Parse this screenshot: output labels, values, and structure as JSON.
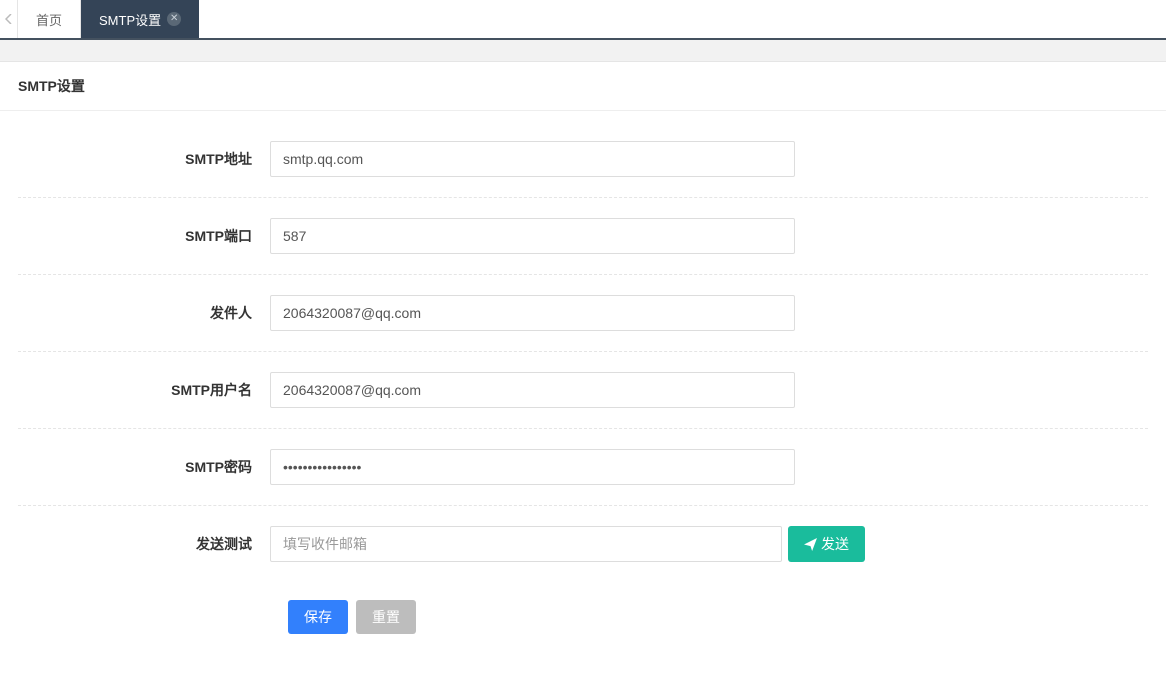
{
  "tabs": {
    "home": "首页",
    "active": "SMTP设置"
  },
  "panel": {
    "title": "SMTP设置"
  },
  "form": {
    "smtp_addr": {
      "label": "SMTP地址",
      "value": "smtp.qq.com"
    },
    "smtp_port": {
      "label": "SMTP端口",
      "value": "587"
    },
    "sender": {
      "label": "发件人",
      "value": "2064320087@qq.com"
    },
    "smtp_user": {
      "label": "SMTP用户名",
      "value": "2064320087@qq.com"
    },
    "smtp_pass": {
      "label": "SMTP密码",
      "value": "••••••••••••••••"
    },
    "test": {
      "label": "发送测试",
      "placeholder": "填写收件邮箱",
      "send_label": "发送"
    }
  },
  "actions": {
    "save": "保存",
    "reset": "重置"
  }
}
